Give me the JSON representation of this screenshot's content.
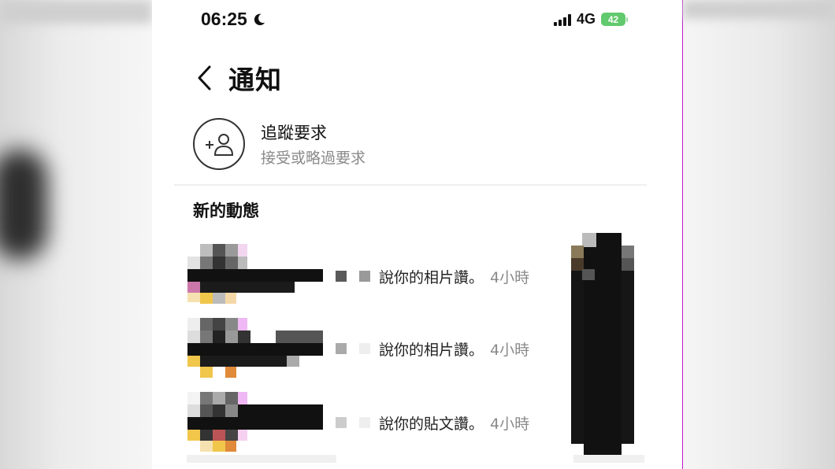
{
  "status_bar": {
    "time": "06:25",
    "network": "4G",
    "battery": "42"
  },
  "header": {
    "title": "通知"
  },
  "follow_requests": {
    "title": "追蹤要求",
    "subtitle": "接受或略過要求"
  },
  "activity": {
    "section_title": "新的動態",
    "items": [
      {
        "message": "說你的相片讚。",
        "time": "4小時"
      },
      {
        "message": "說你的相片讚。",
        "time": "4小時"
      },
      {
        "message": "說你的貼文讚。",
        "time": "4小時"
      }
    ]
  },
  "icons": [
    "moon-icon",
    "signal-icon",
    "battery-icon",
    "back-icon",
    "add-person-icon"
  ],
  "colors": {
    "battery": "#61c96e",
    "secondary_text": "#8a8a8a"
  }
}
